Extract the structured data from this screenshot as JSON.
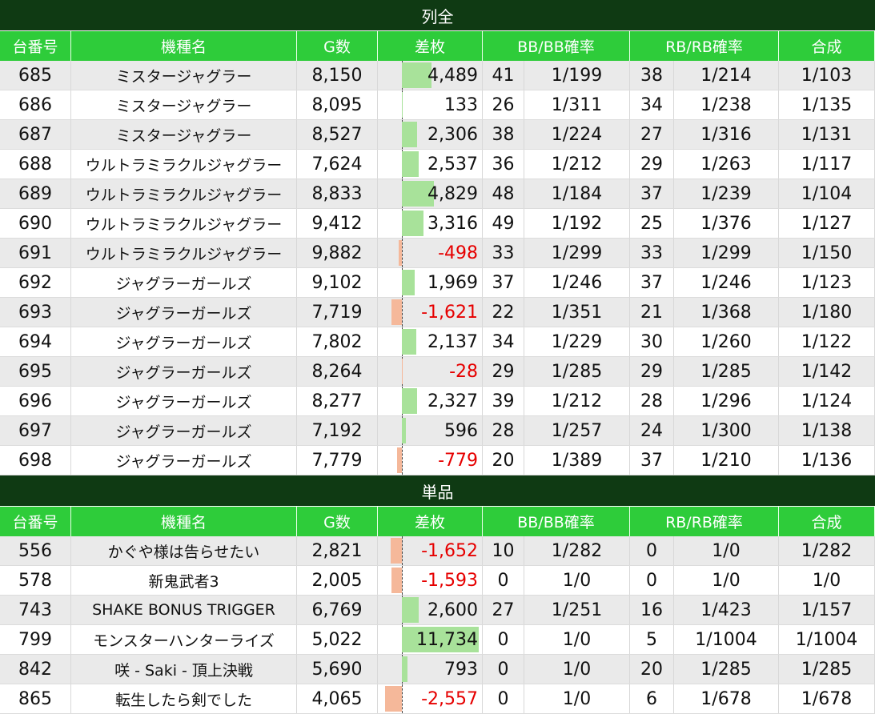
{
  "headers": [
    "台番号",
    "機種名",
    "G数",
    "差枚",
    "BB/BB確率",
    "RB/RB確率",
    "合成"
  ],
  "sections": [
    {
      "title": "列全",
      "rows": [
        {
          "no": "685",
          "name": "ミスタージャグラー",
          "g": "8,150",
          "sa": "4,489",
          "sa_value": 4489,
          "bb": "41",
          "bbp": "1/199",
          "rb": "38",
          "rbp": "1/214",
          "gosei": "1/103"
        },
        {
          "no": "686",
          "name": "ミスタージャグラー",
          "g": "8,095",
          "sa": "133",
          "sa_value": 133,
          "bb": "26",
          "bbp": "1/311",
          "rb": "34",
          "rbp": "1/238",
          "gosei": "1/135"
        },
        {
          "no": "687",
          "name": "ミスタージャグラー",
          "g": "8,527",
          "sa": "2,306",
          "sa_value": 2306,
          "bb": "38",
          "bbp": "1/224",
          "rb": "27",
          "rbp": "1/316",
          "gosei": "1/131"
        },
        {
          "no": "688",
          "name": "ウルトラミラクルジャグラー",
          "g": "7,624",
          "sa": "2,537",
          "sa_value": 2537,
          "bb": "36",
          "bbp": "1/212",
          "rb": "29",
          "rbp": "1/263",
          "gosei": "1/117"
        },
        {
          "no": "689",
          "name": "ウルトラミラクルジャグラー",
          "g": "8,833",
          "sa": "4,829",
          "sa_value": 4829,
          "bb": "48",
          "bbp": "1/184",
          "rb": "37",
          "rbp": "1/239",
          "gosei": "1/104"
        },
        {
          "no": "690",
          "name": "ウルトラミラクルジャグラー",
          "g": "9,412",
          "sa": "3,316",
          "sa_value": 3316,
          "bb": "49",
          "bbp": "1/192",
          "rb": "25",
          "rbp": "1/376",
          "gosei": "1/127"
        },
        {
          "no": "691",
          "name": "ウルトラミラクルジャグラー",
          "g": "9,882",
          "sa": "-498",
          "sa_value": -498,
          "bb": "33",
          "bbp": "1/299",
          "rb": "33",
          "rbp": "1/299",
          "gosei": "1/150"
        },
        {
          "no": "692",
          "name": "ジャグラーガールズ",
          "g": "9,102",
          "sa": "1,969",
          "sa_value": 1969,
          "bb": "37",
          "bbp": "1/246",
          "rb": "37",
          "rbp": "1/246",
          "gosei": "1/123"
        },
        {
          "no": "693",
          "name": "ジャグラーガールズ",
          "g": "7,719",
          "sa": "-1,621",
          "sa_value": -1621,
          "bb": "22",
          "bbp": "1/351",
          "rb": "21",
          "rbp": "1/368",
          "gosei": "1/180"
        },
        {
          "no": "694",
          "name": "ジャグラーガールズ",
          "g": "7,802",
          "sa": "2,137",
          "sa_value": 2137,
          "bb": "34",
          "bbp": "1/229",
          "rb": "30",
          "rbp": "1/260",
          "gosei": "1/122"
        },
        {
          "no": "695",
          "name": "ジャグラーガールズ",
          "g": "8,264",
          "sa": "-28",
          "sa_value": -28,
          "bb": "29",
          "bbp": "1/285",
          "rb": "29",
          "rbp": "1/285",
          "gosei": "1/142"
        },
        {
          "no": "696",
          "name": "ジャグラーガールズ",
          "g": "8,277",
          "sa": "2,327",
          "sa_value": 2327,
          "bb": "39",
          "bbp": "1/212",
          "rb": "28",
          "rbp": "1/296",
          "gosei": "1/124"
        },
        {
          "no": "697",
          "name": "ジャグラーガールズ",
          "g": "7,192",
          "sa": "596",
          "sa_value": 596,
          "bb": "28",
          "bbp": "1/257",
          "rb": "24",
          "rbp": "1/300",
          "gosei": "1/138"
        },
        {
          "no": "698",
          "name": "ジャグラーガールズ",
          "g": "7,779",
          "sa": "-779",
          "sa_value": -779,
          "bb": "20",
          "bbp": "1/389",
          "rb": "37",
          "rbp": "1/210",
          "gosei": "1/136"
        }
      ]
    },
    {
      "title": "単品",
      "rows": [
        {
          "no": "556",
          "name": "かぐや様は告らせたい",
          "g": "2,821",
          "sa": "-1,652",
          "sa_value": -1652,
          "bb": "10",
          "bbp": "1/282",
          "rb": "0",
          "rbp": "1/0",
          "gosei": "1/282"
        },
        {
          "no": "578",
          "name": "新鬼武者3",
          "g": "2,005",
          "sa": "-1,593",
          "sa_value": -1593,
          "bb": "0",
          "bbp": "1/0",
          "rb": "0",
          "rbp": "1/0",
          "gosei": "1/0"
        },
        {
          "no": "743",
          "name": "SHAKE BONUS TRIGGER",
          "g": "6,769",
          "sa": "2,600",
          "sa_value": 2600,
          "bb": "27",
          "bbp": "1/251",
          "rb": "16",
          "rbp": "1/423",
          "gosei": "1/157"
        },
        {
          "no": "799",
          "name": "モンスターハンターライズ",
          "g": "5,022",
          "sa": "11,734",
          "sa_value": 11734,
          "bb": "0",
          "bbp": "1/0",
          "rb": "5",
          "rbp": "1/1004",
          "gosei": "1/1004"
        },
        {
          "no": "842",
          "name": "咲 - Saki -  頂上決戦",
          "g": "5,690",
          "sa": "793",
          "sa_value": 793,
          "bb": "0",
          "bbp": "1/0",
          "rb": "20",
          "rbp": "1/285",
          "gosei": "1/285"
        },
        {
          "no": "865",
          "name": "転生したら剣でした",
          "g": "4,065",
          "sa": "-2,557",
          "sa_value": -2557,
          "bb": "0",
          "bbp": "1/0",
          "rb": "6",
          "rbp": "1/678",
          "gosei": "1/678"
        }
      ]
    }
  ],
  "colors": {
    "positive_bar": "#a8e29a",
    "negative_bar": "#f5b89a",
    "negative_text": "#e60000",
    "header_bg": "#2ecc3a",
    "title_bg": "#0f3a13"
  }
}
